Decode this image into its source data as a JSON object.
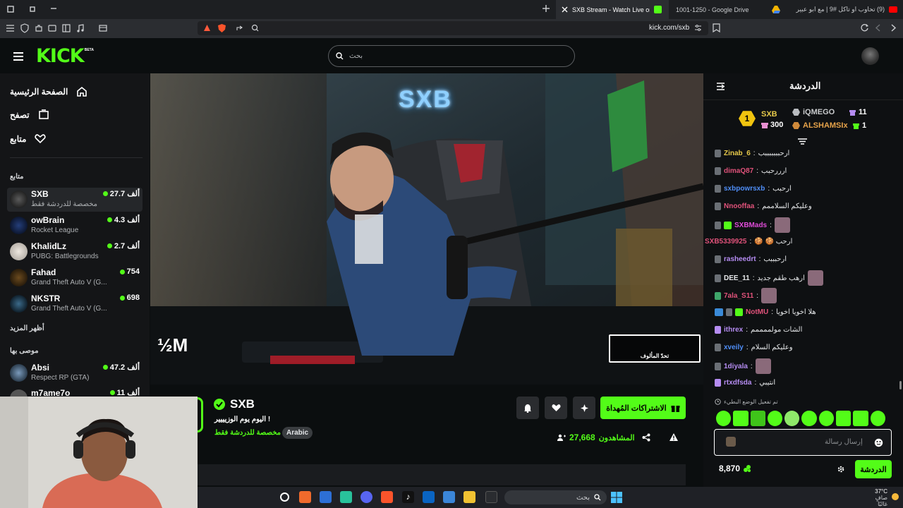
{
  "browser": {
    "tabs": [
      {
        "label": "SXB Stream - Watch Live on Kick",
        "active": true
      },
      {
        "label": "1001-1250 - Google Drive",
        "active": false
      },
      {
        "label": "(9) تحاوب او تاكل #9 | مع ابو عبير",
        "active": false
      }
    ],
    "url": "kick.com/sxb"
  },
  "header": {
    "logo": "KICK",
    "logo_badge": "BETA",
    "search_placeholder": "بحث"
  },
  "sidebar": {
    "nav": [
      {
        "label": "الصفحة الرئيسية",
        "icon": "home-icon"
      },
      {
        "label": "تصفح",
        "icon": "browse-icon"
      },
      {
        "label": "متابع",
        "icon": "heart-icon"
      }
    ],
    "following_title": "متابع",
    "following": [
      {
        "name": "SXB",
        "category": "مخصصة للدردشة فقط",
        "viewers": "27.7 ألف"
      },
      {
        "name": "owBrain",
        "category": "Rocket League",
        "viewers": "4.3 ألف"
      },
      {
        "name": "KhalidLz",
        "category": "PUBG: Battlegrounds",
        "viewers": "2.7 ألف"
      },
      {
        "name": "Fahad",
        "category": "Grand Theft Auto V (G...",
        "viewers": "754"
      },
      {
        "name": "NKSTR",
        "category": "Grand Theft Auto V (G...",
        "viewers": "698"
      }
    ],
    "show_more": "أظهر المزيد",
    "recommended_title": "موصى بها",
    "recommended": [
      {
        "name": "Absi",
        "category": "Respect RP (GTA)",
        "viewers": "47.2 ألف"
      },
      {
        "name": "m7ame7o",
        "category": "",
        "viewers": "11 ألف"
      }
    ]
  },
  "video": {
    "logo_text": "SXB",
    "watermark_left": "½M",
    "watermark_right": "تحدّ المألوف"
  },
  "stream": {
    "channel_name": "SXB",
    "title": "! اليوم يوم الوزيييير",
    "category": "مخصصة للدردشة فقط",
    "language": "Arabic",
    "gift_button": "الاشتراكات المُهداة",
    "viewers": "27,668",
    "viewers_label": "المشاهدون"
  },
  "chat": {
    "title": "الدردشة",
    "gifters": [
      {
        "rank": "1",
        "name": "SXB",
        "count": "300"
      },
      {
        "name": "iQMEGO",
        "count": "11"
      },
      {
        "name": "ALSHAMSIx",
        "count": "1"
      }
    ],
    "messages": [
      {
        "user": "Zinab_6",
        "color": "#e6c94a",
        "text": "ارحبببببببب"
      },
      {
        "user": "dimaQ87",
        "color": "#e0527a",
        "text": "ارررحبب"
      },
      {
        "user": "sxbpowrsxb",
        "color": "#4f8ef7",
        "text": "ارحبب"
      },
      {
        "user": "Nnooffaa",
        "color": "#e0527a",
        "text": "وعليكم السلاممم"
      },
      {
        "user": "SXBMads",
        "color": "#e04cd9",
        "text": ""
      },
      {
        "user": "SXB5339925",
        "color": "#e0527a",
        "text": "ارحب 🍪 🍪"
      },
      {
        "user": "rasheedrt",
        "color": "#b58cf2",
        "text": "ارحبببب"
      },
      {
        "user": "DEE_11",
        "color": "#e6e8ea",
        "text": "ارهب طقم جديد"
      },
      {
        "user": "7ala_S11",
        "color": "#e0527a",
        "text": ""
      },
      {
        "user": "NotMU",
        "color": "#e0527a",
        "text": "هلا اخويا اخويا"
      },
      {
        "user": "ithrex",
        "color": "#b58cf2",
        "text": "الشات مولممممم"
      },
      {
        "user": "xveily",
        "color": "#4f8ef7",
        "text": "وعليكم السلام"
      },
      {
        "user": "1diyala",
        "color": "#b58cf2",
        "text": ""
      },
      {
        "user": "rtxdfsda",
        "color": "#b58cf2",
        "text": "انتيبي"
      }
    ],
    "slow_mode": "تم تفعيل الوضع البطيء",
    "input_placeholder": "إرسال رسالة",
    "points": "8,870",
    "send_button": "الدردشة"
  },
  "taskbar": {
    "search": "بحث",
    "temperature": "37°C",
    "weather": "صافٍ غالبًا"
  },
  "colors": {
    "brand": "#53fc18",
    "background": "#0b0e0f"
  }
}
